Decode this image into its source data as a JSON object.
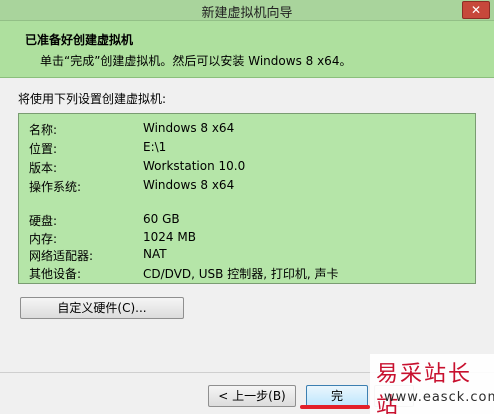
{
  "window": {
    "title": "新建虚拟机向导",
    "close_glyph": "✕"
  },
  "header": {
    "title": "已准备好创建虚拟机",
    "subtitle": "单击“完成”创建虚拟机。然后可以安装 Windows 8 x64。"
  },
  "prompt": "将使用下列设置创建虚拟机:",
  "settings": [
    {
      "key": "名称:",
      "value": "Windows 8 x64"
    },
    {
      "key": "位置:",
      "value": "E:\\1"
    },
    {
      "key": "版本:",
      "value": "Workstation 10.0"
    },
    {
      "key": "操作系统:",
      "value": "Windows 8 x64"
    },
    {
      "key": "硬盘:",
      "value": "60 GB"
    },
    {
      "key": "内存:",
      "value": "1024 MB"
    },
    {
      "key": "网络适配器:",
      "value": "NAT"
    },
    {
      "key": "其他设备:",
      "value": "CD/DVD, USB 控制器, 打印机, 声卡"
    }
  ],
  "buttons": {
    "customize_hardware": "自定义硬件(C)...",
    "back": "< 上一步(B)",
    "finish": "完",
    "cancel": ""
  },
  "watermark": {
    "text": "易采站长站",
    "url": "www.easck.com"
  },
  "colors": {
    "header_bg": "#aee09e",
    "summary_bg": "#b5e5a8",
    "annotation_underline": "#e3202a"
  }
}
